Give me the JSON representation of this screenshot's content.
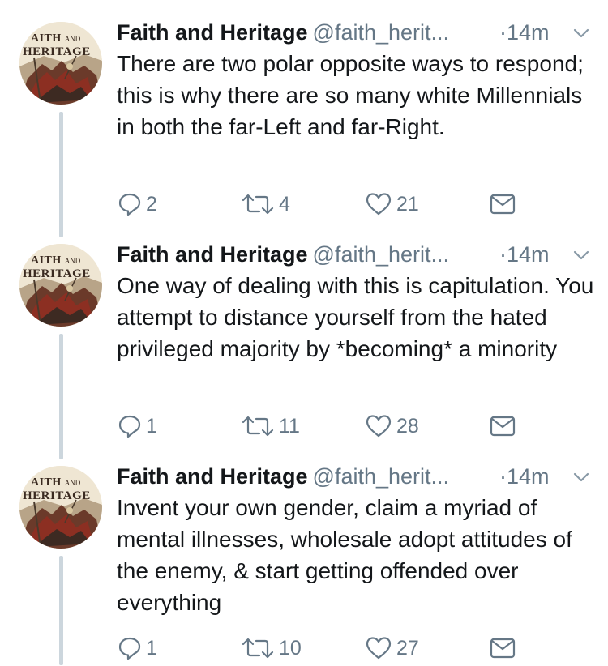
{
  "tweets": [
    {
      "author": "Faith and Heritage",
      "handle": "@faith_herit...",
      "time": "·14m",
      "text": "There are two polar opposite ways to respond; this is why there are so many white Millennials in both the far-Left and far-Right.",
      "replies": "2",
      "retweets": "4",
      "likes": "21",
      "avatar": {
        "line1": "AITH",
        "line1_small": "AND",
        "line2": "HERITAGE"
      }
    },
    {
      "author": "Faith and Heritage",
      "handle": "@faith_herit...",
      "time": "·14m",
      "text": "One way of dealing with this is capitulation. You attempt to distance yourself from the hated privileged majority by *becoming* a minority",
      "replies": "1",
      "retweets": "11",
      "likes": "28",
      "avatar": {
        "line1": "AITH",
        "line1_small": "AND",
        "line2": "HERITAGE"
      }
    },
    {
      "author": "Faith and Heritage",
      "handle": "@faith_herit...",
      "time": "·14m",
      "text": "Invent your own gender, claim a myriad of mental illnesses, wholesale adopt attitudes of the enemy, & start getting offended over everything",
      "replies": "1",
      "retweets": "10",
      "likes": "27",
      "avatar": {
        "line1": "AITH",
        "line1_small": "AND",
        "line2": "HERITAGE"
      }
    }
  ],
  "icons": {
    "reply": "reply-icon",
    "retweet": "retweet-icon",
    "like": "heart-icon",
    "dm": "envelope-icon",
    "caret": "chevron-down-icon"
  },
  "colors": {
    "text": "#14171a",
    "secondary": "#657786",
    "thread_line": "#ccd6dd"
  }
}
